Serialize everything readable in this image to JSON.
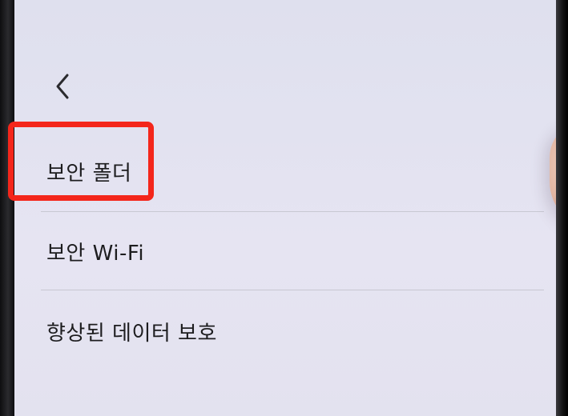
{
  "navigation": {
    "back_icon": "chevron-left-icon"
  },
  "menu": {
    "items": [
      {
        "label": "보안 폴더"
      },
      {
        "label": "보안 Wi-Fi"
      },
      {
        "label": "향상된 데이터 보호"
      }
    ]
  },
  "annotation": {
    "highlight_color": "#f4261b"
  },
  "colors": {
    "screen_background": "#e2e2f0",
    "text": "#1d1d1f",
    "divider": "#c8c8d2"
  }
}
